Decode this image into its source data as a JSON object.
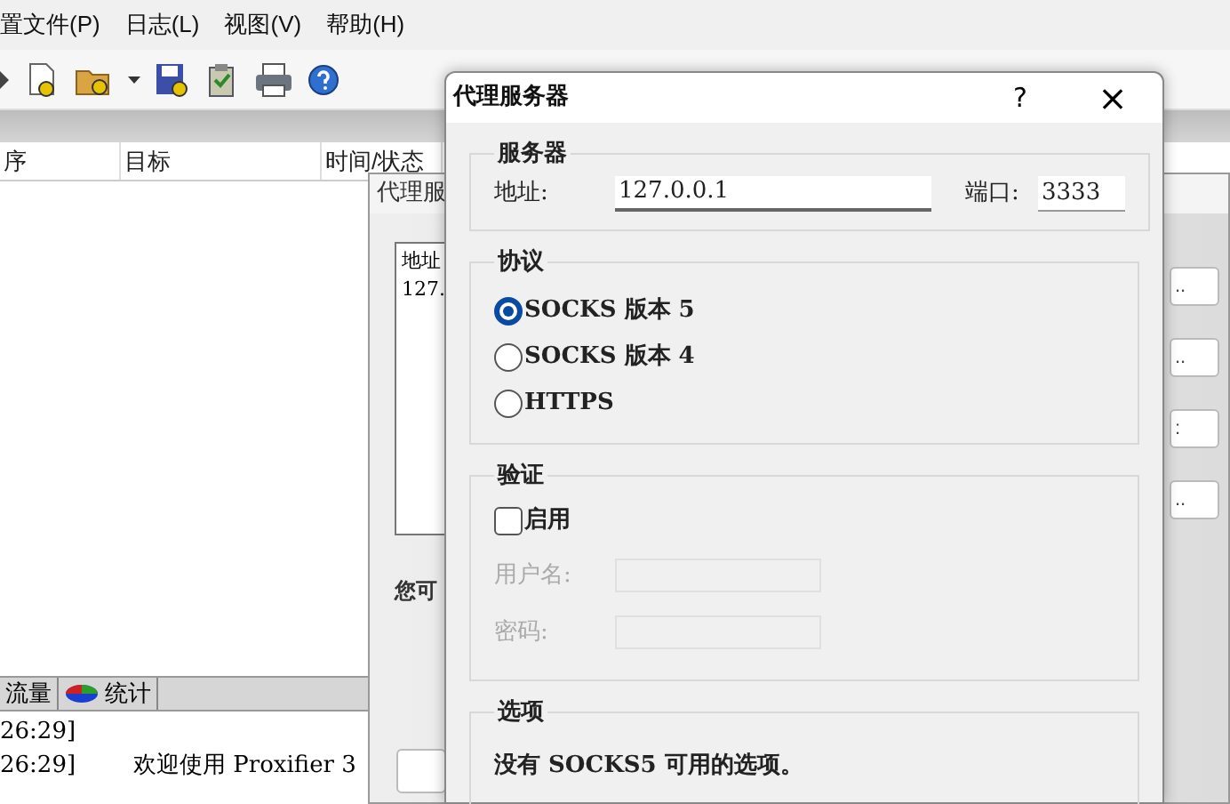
{
  "main_window": {
    "menu": [
      "置文件(P)",
      "日志(L)",
      "视图(V)",
      "帮助(H)"
    ],
    "list_columns": [
      "序",
      "目标",
      "时间/状态"
    ],
    "bottom_tabs": [
      {
        "label": "流量",
        "selected": false
      },
      {
        "label": "统计",
        "selected": false
      }
    ],
    "log_lines": [
      {
        "time": "26:29]"
      },
      {
        "time": "26:29]",
        "message": "欢迎使用 Proxifier 3"
      }
    ]
  },
  "back_dialog": {
    "title": "代理服",
    "list_lines": [
      "地址",
      "127."
    ],
    "note": "您可",
    "side_buttons": [
      "..",
      "..",
      ":",
      ".."
    ]
  },
  "dialog": {
    "title": "代理服务器",
    "help": "?",
    "close": "×",
    "server": {
      "title": "服务器",
      "address_label": "地址:",
      "address": "127.0.0.1",
      "port_label": "端口:",
      "port": "3333"
    },
    "protocol": {
      "title": "协议",
      "options": [
        {
          "label": "SOCKS 版本 5",
          "selected": true
        },
        {
          "label": "SOCKS 版本 4",
          "selected": false
        },
        {
          "label": "HTTPS",
          "selected": false
        }
      ]
    },
    "auth": {
      "title": "验证",
      "enable": {
        "label": "启用",
        "checked": false
      },
      "fields": [
        {
          "label": "用户名:",
          "disabled": true
        },
        {
          "label": "密码:",
          "disabled": true
        }
      ]
    },
    "options": {
      "title": "选项",
      "text": "没有 SOCKS5 可用的选项。"
    }
  }
}
